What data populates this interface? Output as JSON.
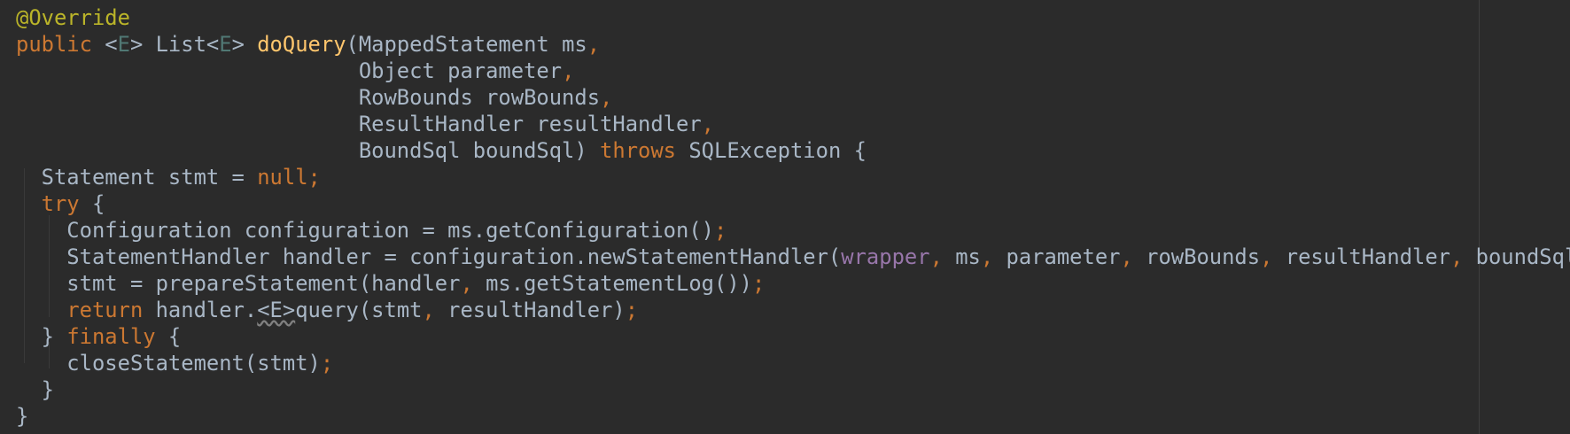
{
  "editor": {
    "theme": "darcula",
    "colors": {
      "background": "#2b2b2b",
      "default_text": "#a9b7c6",
      "keyword": "#cc7832",
      "annotation": "#bbb529",
      "method_declaration": "#ffc66d",
      "type_parameter": "#507874",
      "field": "#9876aa"
    },
    "lines": [
      [
        {
          "t": "@Override",
          "c": "ann"
        }
      ],
      [
        {
          "t": "public",
          "c": "kw"
        },
        {
          "t": " <"
        },
        {
          "t": "E",
          "c": "tp"
        },
        {
          "t": "> List<"
        },
        {
          "t": "E",
          "c": "tp"
        },
        {
          "t": "> "
        },
        {
          "t": "doQuery",
          "c": "fn"
        },
        {
          "t": "(MappedStatement ms"
        },
        {
          "t": ",",
          "c": "kw"
        }
      ],
      [
        {
          "t": "                           Object parameter"
        },
        {
          "t": ",",
          "c": "kw"
        }
      ],
      [
        {
          "t": "                           RowBounds rowBounds"
        },
        {
          "t": ",",
          "c": "kw"
        }
      ],
      [
        {
          "t": "                           ResultHandler resultHandler"
        },
        {
          "t": ",",
          "c": "kw"
        }
      ],
      [
        {
          "t": "                           BoundSql boundSql) "
        },
        {
          "t": "throws",
          "c": "kw"
        },
        {
          "t": " SQLException {"
        }
      ],
      [
        {
          "t": "  Statement stmt = "
        },
        {
          "t": "null",
          "c": "kw"
        },
        {
          "t": ";",
          "c": "kw"
        }
      ],
      [
        {
          "t": "  "
        },
        {
          "t": "try",
          "c": "kw"
        },
        {
          "t": " {"
        }
      ],
      [
        {
          "t": "    Configuration configuration = ms.getConfiguration()"
        },
        {
          "t": ";",
          "c": "kw"
        }
      ],
      [
        {
          "t": "    StatementHandler handler = configuration.newStatementHandler("
        },
        {
          "t": "wrapper",
          "c": "fld"
        },
        {
          "t": ",",
          "c": "kw"
        },
        {
          "t": " ms"
        },
        {
          "t": ",",
          "c": "kw"
        },
        {
          "t": " parameter"
        },
        {
          "t": ",",
          "c": "kw"
        },
        {
          "t": " rowBounds"
        },
        {
          "t": ",",
          "c": "kw"
        },
        {
          "t": " resultHandler"
        },
        {
          "t": ",",
          "c": "kw"
        },
        {
          "t": " boundSql)"
        },
        {
          "t": ";",
          "c": "kw"
        }
      ],
      [
        {
          "t": "    stmt = prepareStatement(handler"
        },
        {
          "t": ",",
          "c": "kw"
        },
        {
          "t": " ms.getStatementLog())"
        },
        {
          "t": ";",
          "c": "kw"
        }
      ],
      [
        {
          "t": "    "
        },
        {
          "t": "return",
          "c": "kw"
        },
        {
          "t": " handler."
        },
        {
          "t": "<E>",
          "c": "wavy"
        },
        {
          "t": "query(stmt"
        },
        {
          "t": ",",
          "c": "kw"
        },
        {
          "t": " resultHandler)"
        },
        {
          "t": ";",
          "c": "kw"
        }
      ],
      [
        {
          "t": "  } "
        },
        {
          "t": "finally",
          "c": "kw"
        },
        {
          "t": " {"
        }
      ],
      [
        {
          "t": "    closeStatement(stmt)"
        },
        {
          "t": ";",
          "c": "kw"
        }
      ],
      [
        {
          "t": "  }"
        }
      ],
      [
        {
          "t": "}"
        }
      ]
    ]
  }
}
